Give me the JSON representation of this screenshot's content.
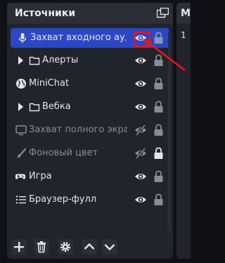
{
  "panel": {
    "title": "Источники",
    "items": [
      {
        "label": "Захват входного аудио",
        "icon": "microphone-icon",
        "selected": true,
        "visible": true,
        "locked": true
      },
      {
        "label": "Алерты",
        "icon": "folder-icon",
        "group": true,
        "visible": true,
        "locked": true
      },
      {
        "label": "MiniChat",
        "icon": "globe-icon",
        "visible": true,
        "locked": true
      },
      {
        "label": "Вебка",
        "icon": "folder-icon",
        "group": true,
        "visible": true,
        "locked": true
      },
      {
        "label": "Захват полного экран",
        "icon": "monitor-icon",
        "visible": false,
        "locked": true
      },
      {
        "label": "Фоновый цвет",
        "icon": "brush-icon",
        "visible": false,
        "locked": false
      },
      {
        "label": "Игра",
        "icon": "gamepad-icon",
        "visible": true,
        "locked": true
      },
      {
        "label": "Браузер-фулл",
        "icon": "list-icon",
        "visible": true,
        "locked": true
      }
    ]
  },
  "right_panel": {
    "title_fragment": "М",
    "item_index": "1"
  },
  "colors": {
    "selected": "#2b47c6",
    "highlight": "#ee1515"
  }
}
